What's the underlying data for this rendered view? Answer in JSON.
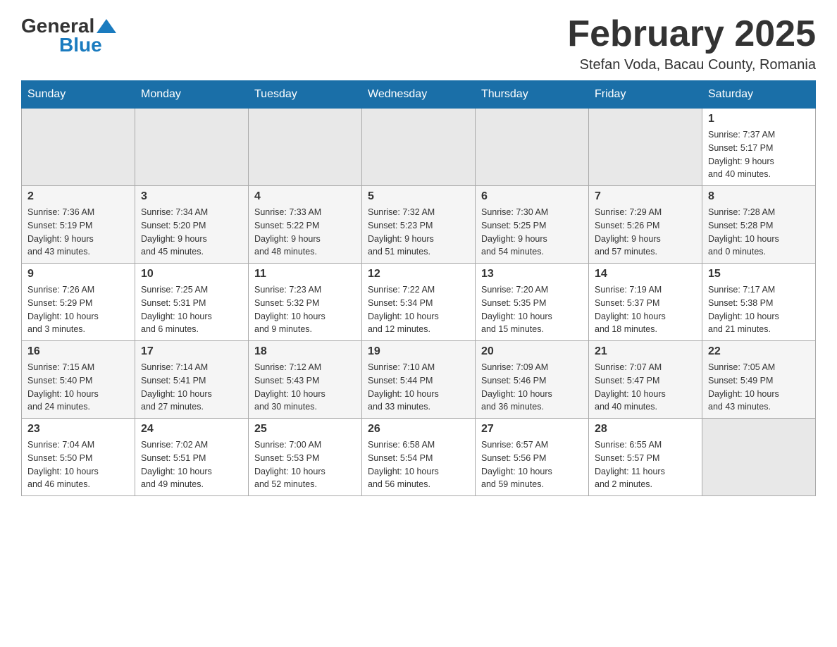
{
  "header": {
    "logo_general": "General",
    "logo_blue": "Blue",
    "title": "February 2025",
    "subtitle": "Stefan Voda, Bacau County, Romania"
  },
  "days_of_week": [
    "Sunday",
    "Monday",
    "Tuesday",
    "Wednesday",
    "Thursday",
    "Friday",
    "Saturday"
  ],
  "weeks": [
    {
      "days": [
        {
          "num": "",
          "info": ""
        },
        {
          "num": "",
          "info": ""
        },
        {
          "num": "",
          "info": ""
        },
        {
          "num": "",
          "info": ""
        },
        {
          "num": "",
          "info": ""
        },
        {
          "num": "",
          "info": ""
        },
        {
          "num": "1",
          "info": "Sunrise: 7:37 AM\nSunset: 5:17 PM\nDaylight: 9 hours\nand 40 minutes."
        }
      ]
    },
    {
      "days": [
        {
          "num": "2",
          "info": "Sunrise: 7:36 AM\nSunset: 5:19 PM\nDaylight: 9 hours\nand 43 minutes."
        },
        {
          "num": "3",
          "info": "Sunrise: 7:34 AM\nSunset: 5:20 PM\nDaylight: 9 hours\nand 45 minutes."
        },
        {
          "num": "4",
          "info": "Sunrise: 7:33 AM\nSunset: 5:22 PM\nDaylight: 9 hours\nand 48 minutes."
        },
        {
          "num": "5",
          "info": "Sunrise: 7:32 AM\nSunset: 5:23 PM\nDaylight: 9 hours\nand 51 minutes."
        },
        {
          "num": "6",
          "info": "Sunrise: 7:30 AM\nSunset: 5:25 PM\nDaylight: 9 hours\nand 54 minutes."
        },
        {
          "num": "7",
          "info": "Sunrise: 7:29 AM\nSunset: 5:26 PM\nDaylight: 9 hours\nand 57 minutes."
        },
        {
          "num": "8",
          "info": "Sunrise: 7:28 AM\nSunset: 5:28 PM\nDaylight: 10 hours\nand 0 minutes."
        }
      ]
    },
    {
      "days": [
        {
          "num": "9",
          "info": "Sunrise: 7:26 AM\nSunset: 5:29 PM\nDaylight: 10 hours\nand 3 minutes."
        },
        {
          "num": "10",
          "info": "Sunrise: 7:25 AM\nSunset: 5:31 PM\nDaylight: 10 hours\nand 6 minutes."
        },
        {
          "num": "11",
          "info": "Sunrise: 7:23 AM\nSunset: 5:32 PM\nDaylight: 10 hours\nand 9 minutes."
        },
        {
          "num": "12",
          "info": "Sunrise: 7:22 AM\nSunset: 5:34 PM\nDaylight: 10 hours\nand 12 minutes."
        },
        {
          "num": "13",
          "info": "Sunrise: 7:20 AM\nSunset: 5:35 PM\nDaylight: 10 hours\nand 15 minutes."
        },
        {
          "num": "14",
          "info": "Sunrise: 7:19 AM\nSunset: 5:37 PM\nDaylight: 10 hours\nand 18 minutes."
        },
        {
          "num": "15",
          "info": "Sunrise: 7:17 AM\nSunset: 5:38 PM\nDaylight: 10 hours\nand 21 minutes."
        }
      ]
    },
    {
      "days": [
        {
          "num": "16",
          "info": "Sunrise: 7:15 AM\nSunset: 5:40 PM\nDaylight: 10 hours\nand 24 minutes."
        },
        {
          "num": "17",
          "info": "Sunrise: 7:14 AM\nSunset: 5:41 PM\nDaylight: 10 hours\nand 27 minutes."
        },
        {
          "num": "18",
          "info": "Sunrise: 7:12 AM\nSunset: 5:43 PM\nDaylight: 10 hours\nand 30 minutes."
        },
        {
          "num": "19",
          "info": "Sunrise: 7:10 AM\nSunset: 5:44 PM\nDaylight: 10 hours\nand 33 minutes."
        },
        {
          "num": "20",
          "info": "Sunrise: 7:09 AM\nSunset: 5:46 PM\nDaylight: 10 hours\nand 36 minutes."
        },
        {
          "num": "21",
          "info": "Sunrise: 7:07 AM\nSunset: 5:47 PM\nDaylight: 10 hours\nand 40 minutes."
        },
        {
          "num": "22",
          "info": "Sunrise: 7:05 AM\nSunset: 5:49 PM\nDaylight: 10 hours\nand 43 minutes."
        }
      ]
    },
    {
      "days": [
        {
          "num": "23",
          "info": "Sunrise: 7:04 AM\nSunset: 5:50 PM\nDaylight: 10 hours\nand 46 minutes."
        },
        {
          "num": "24",
          "info": "Sunrise: 7:02 AM\nSunset: 5:51 PM\nDaylight: 10 hours\nand 49 minutes."
        },
        {
          "num": "25",
          "info": "Sunrise: 7:00 AM\nSunset: 5:53 PM\nDaylight: 10 hours\nand 52 minutes."
        },
        {
          "num": "26",
          "info": "Sunrise: 6:58 AM\nSunset: 5:54 PM\nDaylight: 10 hours\nand 56 minutes."
        },
        {
          "num": "27",
          "info": "Sunrise: 6:57 AM\nSunset: 5:56 PM\nDaylight: 10 hours\nand 59 minutes."
        },
        {
          "num": "28",
          "info": "Sunrise: 6:55 AM\nSunset: 5:57 PM\nDaylight: 11 hours\nand 2 minutes."
        },
        {
          "num": "",
          "info": ""
        }
      ]
    }
  ]
}
